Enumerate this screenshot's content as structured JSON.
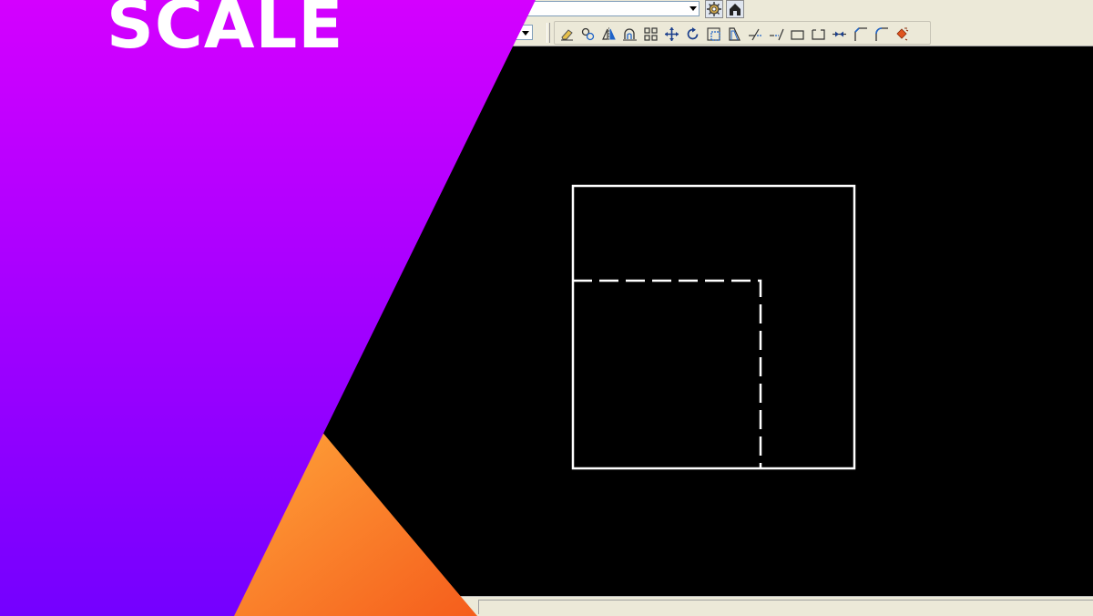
{
  "title": "SCALE",
  "colors": {
    "purple_top": "#d400ff",
    "purple_bottom": "#7400ff",
    "orange_light": "#ffa53a",
    "orange_dark": "#f55d1c",
    "canvas_background": "#000000",
    "drawing_lines": "#ffffff",
    "toolbar_background": "#ece9d8"
  },
  "cad_window": {
    "layer_dropdown": {
      "selected": "",
      "icon": "chevron-down-icon"
    },
    "top_buttons": [
      {
        "name": "layer-settings",
        "icon": "gear-icon"
      },
      {
        "name": "layer-previous",
        "icon": "house-icon"
      }
    ],
    "style_dropdown": {
      "selected": "",
      "icon": "chevron-down-icon"
    },
    "modify_toolbar": [
      {
        "command": "erase",
        "icon": "eraser-icon"
      },
      {
        "command": "copy",
        "icon": "copy-icon"
      },
      {
        "command": "mirror",
        "icon": "mirror-icon"
      },
      {
        "command": "offset",
        "icon": "offset-icon"
      },
      {
        "command": "array",
        "icon": "array-icon"
      },
      {
        "command": "move",
        "icon": "move-icon"
      },
      {
        "command": "rotate",
        "icon": "rotate-icon"
      },
      {
        "command": "scale",
        "icon": "scale-icon"
      },
      {
        "command": "stretch",
        "icon": "stretch-icon"
      },
      {
        "command": "trim",
        "icon": "trim-icon"
      },
      {
        "command": "extend",
        "icon": "extend-icon"
      },
      {
        "command": "break-at-point",
        "icon": "break-at-point-icon"
      },
      {
        "command": "break",
        "icon": "break-icon"
      },
      {
        "command": "join",
        "icon": "join-icon"
      },
      {
        "command": "chamfer",
        "icon": "chamfer-icon"
      },
      {
        "command": "fillet",
        "icon": "fillet-icon"
      },
      {
        "command": "explode",
        "icon": "explode-icon"
      }
    ],
    "drawing": {
      "objects": [
        {
          "kind": "rectangle",
          "linetype": "continuous"
        },
        {
          "kind": "polyline",
          "linetype": "dashed"
        }
      ]
    }
  }
}
